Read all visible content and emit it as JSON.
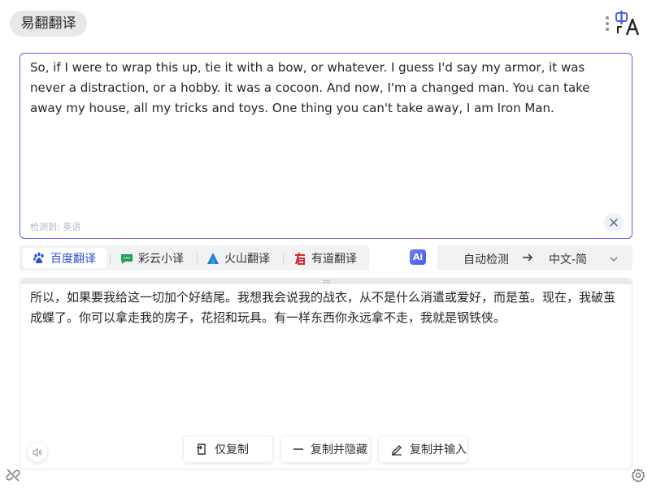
{
  "app": {
    "title": "易翻翻译"
  },
  "header": {
    "menu_icon": "kebab-menu-icon",
    "logo_icon": "translate-logo-icon",
    "logo_text": "中A"
  },
  "source": {
    "text": "So, if I were to wrap this up, tie it with a bow, or whatever. I guess I'd say my armor, it was never a distraction, or a hobby. it was a cocoon. And now, I'm a changed man. You can take away my house, all my tricks and toys. One thing you can't take away, I am Iron Man.",
    "detected_label": "检测到: 英语",
    "clear_icon": "close-icon"
  },
  "engines": [
    {
      "label": "百度翻译",
      "icon": "baidu-paw-icon",
      "active": true
    },
    {
      "label": "彩云小译",
      "icon": "caiyun-chat-icon",
      "active": false
    },
    {
      "label": "火山翻译",
      "icon": "volcano-mountain-icon",
      "active": false
    },
    {
      "label": "有道翻译",
      "icon": "youdao-logo-icon",
      "active": false
    }
  ],
  "ai_badge": "Ai",
  "languages": {
    "from": "自动检测",
    "to": "中文-简",
    "arrow_icon": "arrow-right-icon",
    "chevron_icon": "chevron-down-icon"
  },
  "target": {
    "text": "所以，如果要我给这一切加个好结尾。我想我会说我的战衣，从不是什么消遣或爱好，而是茧。现在，我破茧成蝶了。你可以拿走我的房子，花招和玩具。有一样东西你永远拿不走，我就是钢铁侠。",
    "speaker_icon": "speaker-icon"
  },
  "actions": [
    {
      "label": "仅复制",
      "icon": "copy-icon"
    },
    {
      "label": "复制并隐藏",
      "icon": "minus-icon"
    },
    {
      "label": "复制并输入",
      "icon": "pen-icon"
    }
  ],
  "footer": {
    "left_icon": "unpin-icon",
    "right_icon": "gear-icon"
  },
  "colors": {
    "accent": "#5b63e6",
    "active_engine_text": "#2c4fd8",
    "bar_bg": "#f1f2f4"
  }
}
